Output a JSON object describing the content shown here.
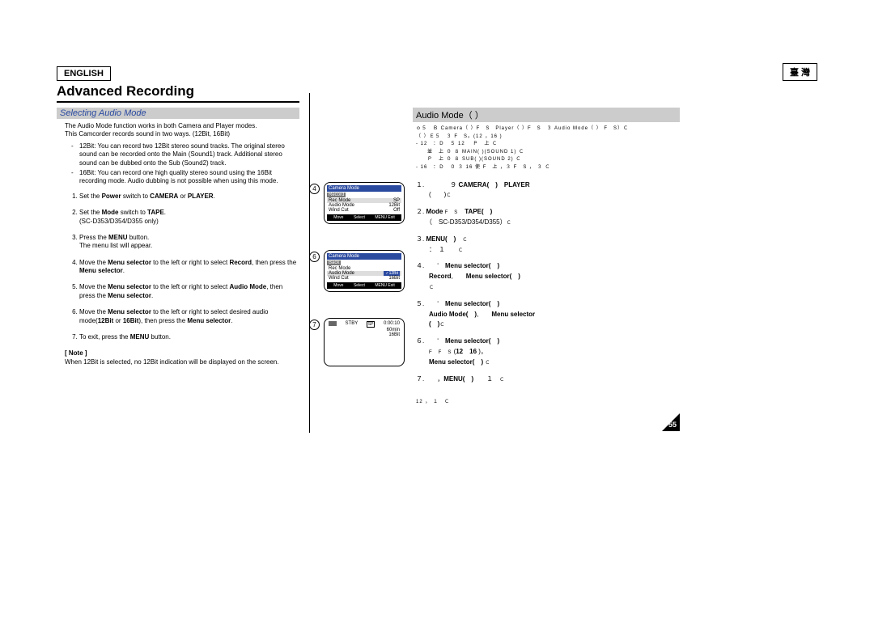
{
  "header": {
    "lang_left": "ENGLISH",
    "lang_right": "臺 灣",
    "title": "Advanced Recording"
  },
  "left": {
    "section_title": "Selecting Audio Mode",
    "intro1": "The Audio Mode function works in both Camera and Player modes.",
    "intro2": "This Camcorder records sound in two ways. (12Bit, 16Bit)",
    "bullets": [
      "12Bit: You can record two 12Bit stereo sound tracks. The original stereo sound can be recorded onto the Main (Sound1) track. Additional stereo sound can be dubbed onto the Sub (Sound2) track.",
      "16Bit: You can record one high quality stereo sound using the 16Bit recording mode. Audio dubbing is not possible when using this mode."
    ],
    "steps": [
      {
        "pre": "Set the ",
        "b1": "Power",
        "mid1": " switch to ",
        "b2": "CAMERA",
        "mid2": " or ",
        "b3": "PLAYER",
        "post": "."
      },
      {
        "pre": "Set the ",
        "b1": "Mode",
        "mid1": " switch to ",
        "b2": "TAPE",
        "post": ".",
        "sub": "(SC-D353/D354/D355 only)"
      },
      {
        "pre": "Press the ",
        "b1": "MENU",
        "post": " button.",
        "sub": "The menu list will appear."
      },
      {
        "pre": "Move the ",
        "b1": "Menu selector",
        "mid1": " to the left or right to select ",
        "b2": "Record",
        "mid2": ", then press the ",
        "b3": "Menu selector",
        "post": "."
      },
      {
        "pre": "Move the ",
        "b1": "Menu selector",
        "mid1": " to the left or right to select ",
        "b2": "Audio Mode",
        "mid2": ", then press the ",
        "b3": "Menu selector",
        "post": "."
      },
      {
        "pre": "Move the ",
        "b1": "Menu selector",
        "mid1": " to the left or right to select desired audio mode(",
        "b2": "12Bit",
        "mid2": " or ",
        "b3": "16Bit",
        "mid3": "), then press the ",
        "b4": "Menu selector",
        "post": "."
      },
      {
        "pre": "To exit, press the ",
        "b1": "MENU",
        "post": " button."
      }
    ],
    "note_head": "[ Note ]",
    "note_body": "When 12Bit is selected, no 12Bit indication will be displayed on the screen."
  },
  "right": {
    "section_title": "Audio Mode（ ）",
    "intro_lines": [
      "ｏ５　Ｂ Camera（ ）F　S　Player（ ）F　S　３ Audio Mode（ ） F　S）Ｃ",
      "（ ）Ｅ５　３  F　S。(12 ，16 )",
      "12　：Ｄ　５  12　 Ｐ　上  Ｃ",
      "並　上  ０  ８ MAIN( )(SOUND 1)  Ｃ",
      "Ｐ　上  ０  ８ SUB( )(SOUND 2)  Ｃ",
      "16　：Ｄ　０  ３ 16  使  F　上 ，３ F　S ，  ３  Ｃ"
    ],
    "steps": [
      "１.　　９ CAMERA(　) PLAYER (　)Ｃ",
      "２. Mode F　S　TAPE(　)（ SC-D353/D354/D355）Ｃ",
      "３. MENU(　)　Ｃ　　：　１　　Ｃ",
      "４.　　‘ Menu selector(　)　Record, Menu selector(　)　Ｃ",
      "５.　　‘ Menu selector(　) Audio Mode(　), Menu selector (　)Ｃ",
      "６.　　‘ Menu selector(　) F  F  S (12　16 )，Menu selector(　) Ｃ",
      "７.　　，MENU(　)　１　Ｃ"
    ],
    "footer_note": "12 ，  １　Ｃ"
  },
  "figures": {
    "f4": {
      "num": "4",
      "title": "Camera Mode",
      "sub": "Record",
      "rows": [
        [
          "Rec Mode",
          "SP"
        ],
        [
          "Audio Mode",
          "12Bit"
        ],
        [
          "Wind Cut",
          "Off"
        ]
      ],
      "footer": [
        "Move",
        "Select",
        "MENU Exit"
      ]
    },
    "f6": {
      "num": "6",
      "title": "Camera Mode",
      "back": "Back",
      "rows": [
        [
          "Rec Mode",
          ""
        ],
        [
          "Audio Mode",
          "✓12Bit"
        ],
        [
          "Wind Cut",
          "16Bit"
        ]
      ],
      "footer": [
        "Move",
        "Select",
        "MENU Exit"
      ]
    },
    "f7": {
      "num": "7",
      "stby": "STBY",
      "sp": "SP",
      "time": "0:00:10",
      "remain": "60min",
      "mode": "16Bit"
    }
  },
  "page_number": "55"
}
